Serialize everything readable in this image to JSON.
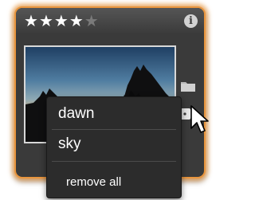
{
  "card": {
    "rating": 4,
    "rating_max": 5,
    "stars": [
      "★",
      "★",
      "★",
      "★",
      "★"
    ],
    "info_icon": "i",
    "accent_color": "#e8953e"
  },
  "icons": {
    "info": "info-icon",
    "folder": "folder-icon",
    "tag": "tag-icon",
    "cursor": "pointer-cursor"
  },
  "menu": {
    "items": [
      {
        "label": "dawn"
      },
      {
        "label": "sky"
      }
    ],
    "remove_all_label": "remove all"
  }
}
